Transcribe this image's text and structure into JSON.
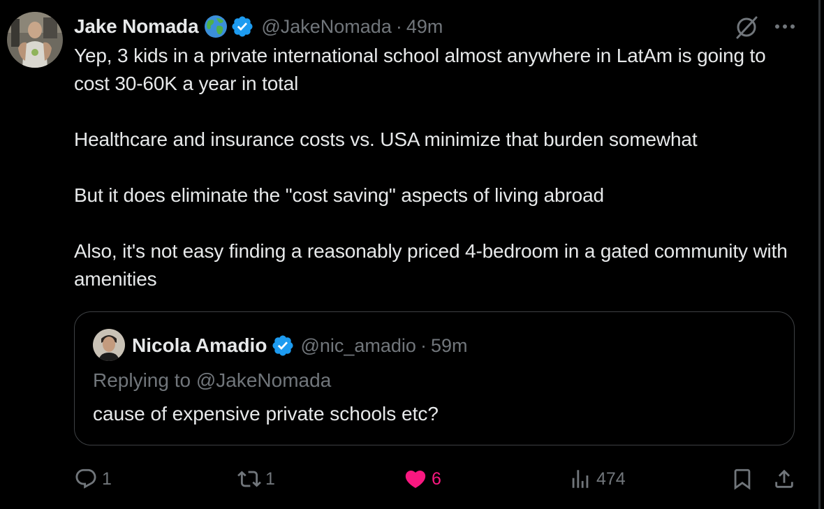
{
  "tweet": {
    "author_name": "Jake Nomada",
    "handle": "@JakeNomada",
    "separator": "·",
    "time": "49m",
    "paragraphs": [
      "Yep, 3 kids in a private international school almost anywhere in LatAm is going to cost 30-60K a year in total",
      "Healthcare and insurance costs vs. USA minimize that burden somewhat",
      "But it does eliminate the \"cost saving\" aspects of living abroad",
      "Also, it's not easy finding a reasonably priced 4-bedroom in a gated community with amenities"
    ]
  },
  "quoted": {
    "author_name": "Nicola Amadio",
    "handle": "@nic_amadio",
    "separator": "·",
    "time": "59m",
    "replying_to": "Replying to @JakeNomada",
    "text": "cause of expensive private schools etc?"
  },
  "actions": {
    "reply_count": "1",
    "repost_count": "1",
    "like_count": "6",
    "views_count": "474"
  },
  "icons": {
    "globe": "globe-icon",
    "verified": "verified-badge-icon",
    "grok": "grok-icon",
    "more": "more-options-icon",
    "reply": "reply-icon",
    "repost": "repost-icon",
    "like": "heart-icon",
    "views": "views-icon",
    "bookmark": "bookmark-icon",
    "share": "share-icon"
  },
  "colors": {
    "background": "#000000",
    "text_primary": "#e7e9ea",
    "text_secondary": "#71767b",
    "verified_blue": "#1d9bf0",
    "like_pink": "#f91880",
    "border": "#3e4144"
  }
}
